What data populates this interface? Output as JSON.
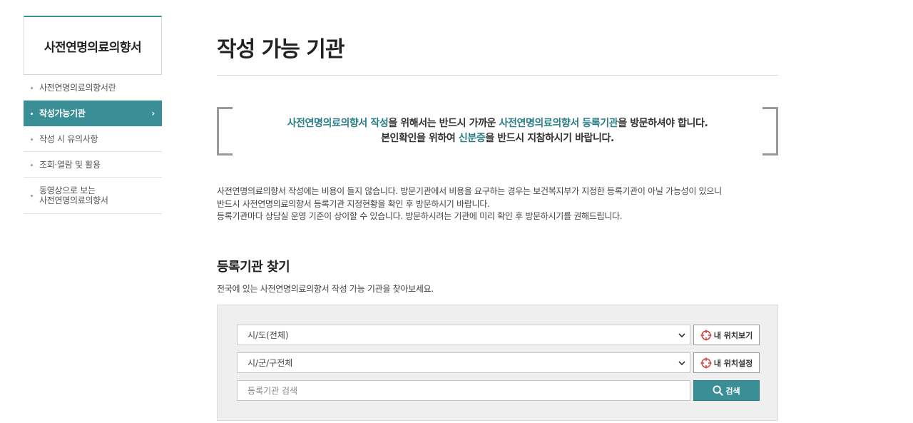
{
  "sidebar": {
    "title": "사전연명의료의향서",
    "items": [
      {
        "label": "사전연명의료의향서란"
      },
      {
        "label": "작성가능기관",
        "active": true
      },
      {
        "label": "작성 시 유의사항"
      },
      {
        "label": "조회·열람 및 활용"
      },
      {
        "label_line1": "동영상으로 보는",
        "label_line2": "사전연명의료의향서"
      }
    ]
  },
  "main": {
    "title": "작성 가능 기관",
    "notice": {
      "line1": {
        "p1": "사전연명의료의향서 작성",
        "p2": "을 위해서는 반드시 가까운 ",
        "p3": "사전연명의료의향서 등록기관",
        "p4": "을 방문하셔야 합니다."
      },
      "line2": {
        "p1": "본인확인을 위하여 ",
        "p2": "신분증",
        "p3": "을 반드시 지참하시기 바랍니다."
      }
    },
    "description": [
      "사전연명의료의향서 작성에는 비용이 들지 않습니다. 방문기관에서 비용을 요구하는 경우는 보건복지부가 지정한 등록기관이 아닐 가능성이 있으니",
      "반드시 사전연명의료의향서 등록기관 지정현황을 확인 후 방문하시기 바랍니다.",
      "등록기관마다 상담실 운영 기준이 상이할 수 있습니다. 방문하시려는 기관에 미리 확인 후 방문하시기를 권해드립니다."
    ],
    "search": {
      "title": "등록기관 찾기",
      "subtitle": "전국에 있는 사전연명의료의향서 작성 가능 기관을 찾아보세요.",
      "province_select": "시/도(전체)",
      "district_select": "시/군/구전체",
      "keyword_placeholder": "등록기관 검색",
      "my_location_view": "내 위치보기",
      "my_location_set": "내 위치설정",
      "search_button": "검색"
    }
  },
  "colors": {
    "accent": "#3a8f97",
    "highlight_text": "#2a7e87",
    "locate_icon": "#d9342b"
  }
}
